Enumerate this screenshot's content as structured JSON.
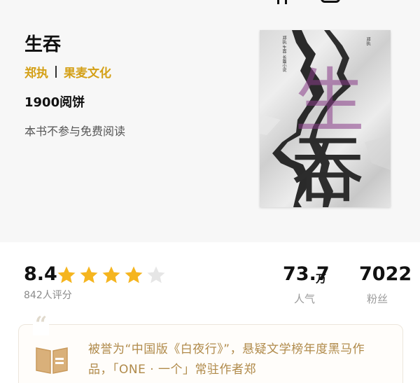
{
  "book": {
    "title": "生吞",
    "author": "郑执",
    "publisher": "果麦文化",
    "price": "1900阅饼",
    "free_note": "本书不参与免费阅读"
  },
  "cover": {
    "char_top": "生",
    "char_bottom": "吞",
    "tagline": "郑执",
    "vertical_text": "郑执 生吞 长篇小说"
  },
  "rating": {
    "score": "8.4",
    "stars": 4,
    "max_stars": 5,
    "count_label": "842人评分"
  },
  "stats": {
    "popularity_value": "73.7",
    "popularity_unit": "万",
    "popularity_label": "人气",
    "fans_value": "7022",
    "fans_label": "粉丝"
  },
  "intro": {
    "quote_glyph": "“",
    "text": "被誉为“中国版《白夜行》”，悬疑文学榜年度黑马作品，「ONE · 一个」常驻作者郑"
  },
  "colors": {
    "accent": "#d4a017",
    "star_on": "#f5b51f",
    "star_off": "#e6e6e6",
    "intro_text": "#b08a4a"
  }
}
